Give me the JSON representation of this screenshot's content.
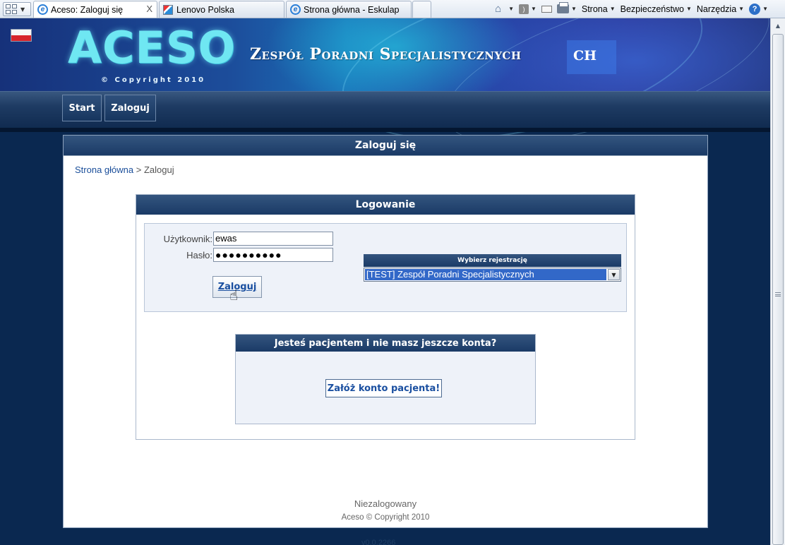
{
  "browser": {
    "tabs": [
      {
        "title": "Aceso: Zaloguj się",
        "active": true
      },
      {
        "title": "Lenovo Polska"
      },
      {
        "title": "Strona główna - Eskulap"
      }
    ],
    "tab_close": "X",
    "command_bar": {
      "page": "Strona",
      "safety": "Bezpieczeństwo",
      "tools": "Narzędzia",
      "help": "?"
    }
  },
  "header": {
    "logo": "ACESO",
    "copyright": "© Copyright 2010",
    "title": "Zespół Poradni Specjalistycznych",
    "title_tail": "CH"
  },
  "nav": {
    "start": "Start",
    "login": "Zaloguj"
  },
  "panel": {
    "title": "Zaloguj się",
    "breadcrumb": {
      "home": "Strona główna",
      "sep": " > ",
      "current": "Zaloguj"
    }
  },
  "login": {
    "title": "Logowanie",
    "user_label": "Użytkownik:",
    "user_value": "ewas",
    "pass_label": "Hasło:",
    "pass_value": "●●●●●●●●●●",
    "submit": "Zaloguj",
    "registration_header": "Wybierz rejestrację",
    "registration_value": "[TEST] Zespół Poradni Specjalistycznych"
  },
  "patient": {
    "question": "Jesteś pacjentem i nie masz jeszcze konta?",
    "create_button": "Załóż konto pacjenta!"
  },
  "footer": {
    "status": "Niezalogowany",
    "copyright": "Aceso © Copyright 2010",
    "version": "v0.0.2266"
  }
}
